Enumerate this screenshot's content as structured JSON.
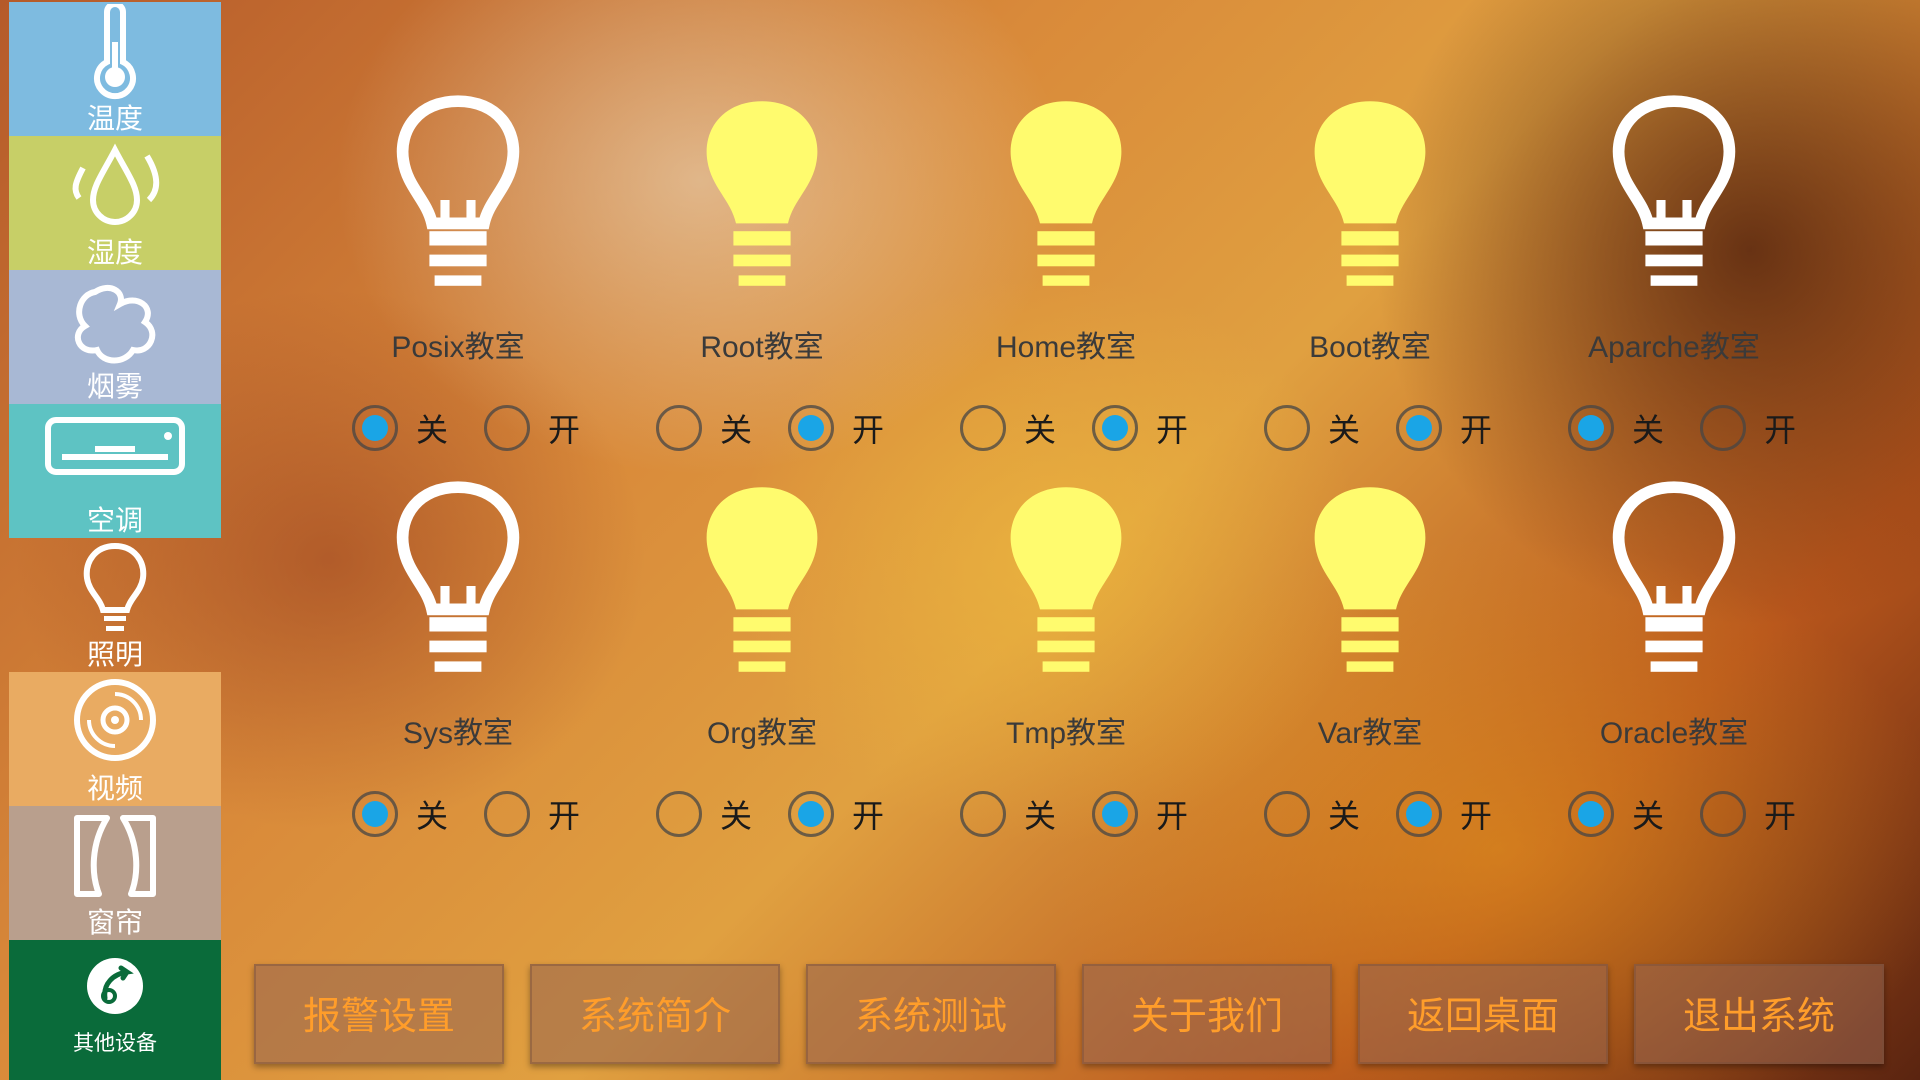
{
  "sidebar": {
    "items": [
      {
        "label": "温度",
        "icon": "thermometer-icon",
        "bg": "#7ebbe0"
      },
      {
        "label": "湿度",
        "icon": "water-drops-icon",
        "bg": "#c7cf67"
      },
      {
        "label": "烟雾",
        "icon": "smoke-icon",
        "bg": "#a8b8d4"
      },
      {
        "label": "空调",
        "icon": "air-conditioner-icon",
        "bg": "#5ec3c3"
      },
      {
        "label": "照明",
        "icon": "lightbulb-icon",
        "bg": "transparent"
      },
      {
        "label": "视频",
        "icon": "disc-icon",
        "bg": "#e9ab62"
      },
      {
        "label": "窗帘",
        "icon": "curtain-icon",
        "bg": "#b99f8d"
      },
      {
        "label": "其他设备",
        "icon": "other-devices-icon",
        "bg": "#0a6b3a"
      }
    ]
  },
  "option_labels": {
    "off": "关",
    "on": "开"
  },
  "rooms": [
    {
      "name": "Posix教室",
      "state": "off"
    },
    {
      "name": "Root教室",
      "state": "on"
    },
    {
      "name": "Home教室",
      "state": "on"
    },
    {
      "name": "Boot教室",
      "state": "on"
    },
    {
      "name": "Aparche教室",
      "state": "off"
    },
    {
      "name": "Sys教室",
      "state": "off"
    },
    {
      "name": "Org教室",
      "state": "on"
    },
    {
      "name": "Tmp教室",
      "state": "on"
    },
    {
      "name": "Var教室",
      "state": "on"
    },
    {
      "name": "Oracle教室",
      "state": "off"
    }
  ],
  "colors": {
    "bulb_on": "#fffb6e",
    "bulb_off": "#ffffff",
    "radio_checked": "#1aa5e6",
    "button_text": "#ff9d2a"
  },
  "bottom_buttons": [
    "报警设置",
    "系统简介",
    "系统测试",
    "关于我们",
    "返回桌面",
    "退出系统"
  ]
}
